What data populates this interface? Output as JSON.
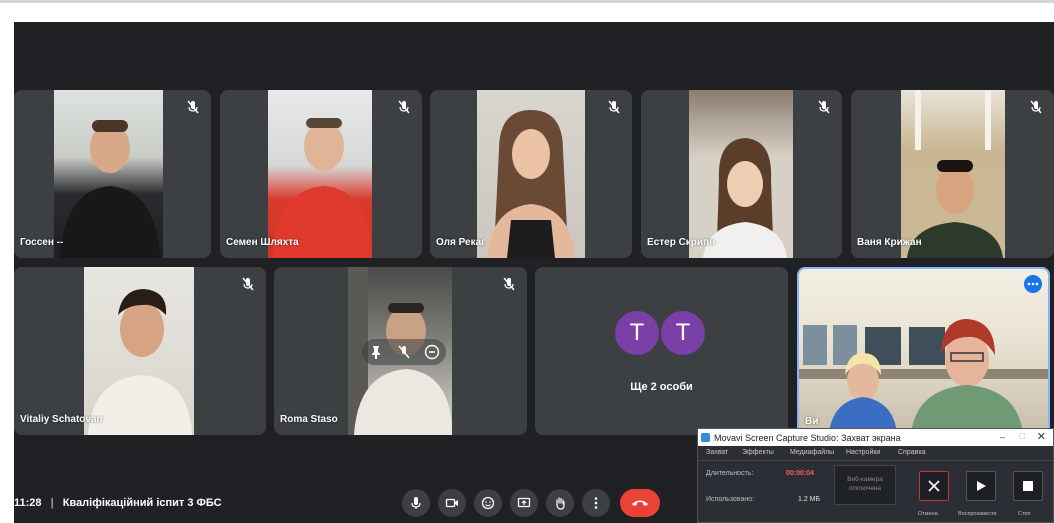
{
  "participants": [
    {
      "name": "Госсен --",
      "muted": true
    },
    {
      "name": "Семен Шляхта",
      "muted": true
    },
    {
      "name": "Оля Рекаг",
      "muted": true
    },
    {
      "name": "Естер Скрипн",
      "muted": true
    },
    {
      "name": "Ваня Крижан",
      "muted": true
    },
    {
      "name": "Vitaliy Schatovan",
      "muted": true
    },
    {
      "name": "Roma Staso",
      "muted": true
    },
    {
      "name": "Ви",
      "muted": false
    }
  ],
  "others_tile": {
    "avatars": [
      "T",
      "T"
    ],
    "label": "Ще 2 особи",
    "avatar_color": "#7b3fa8"
  },
  "meeting": {
    "time": "11:28",
    "separator": "|",
    "title": "Кваліфікаційний іспит 3 ФБС"
  },
  "controls": [
    "microphone-icon",
    "camera-icon",
    "emoji-icon",
    "present-icon",
    "raise-hand-icon",
    "more-options-icon",
    "hang-up-icon"
  ],
  "recorder": {
    "title": "Movavi Screen Capture Studio: Захват экрана",
    "menu": [
      "Захват",
      "Эффекты",
      "Медиафайлы",
      "Настройки",
      "Справка"
    ],
    "duration_label": "Длительность:",
    "duration_value": "00:00:04",
    "used_label": "Использовано:",
    "used_value": "1.2 МБ",
    "webcam_label": "Веб-камера отключена",
    "buttons": [
      "Отмена",
      "Воспроизвести",
      "Стоп"
    ]
  },
  "colors": {
    "meet_bg": "#202124",
    "tile_bg": "#3c4043",
    "hangup": "#ea4335",
    "duration": "#ff5a5a",
    "active_border": "#8ab4f8"
  }
}
